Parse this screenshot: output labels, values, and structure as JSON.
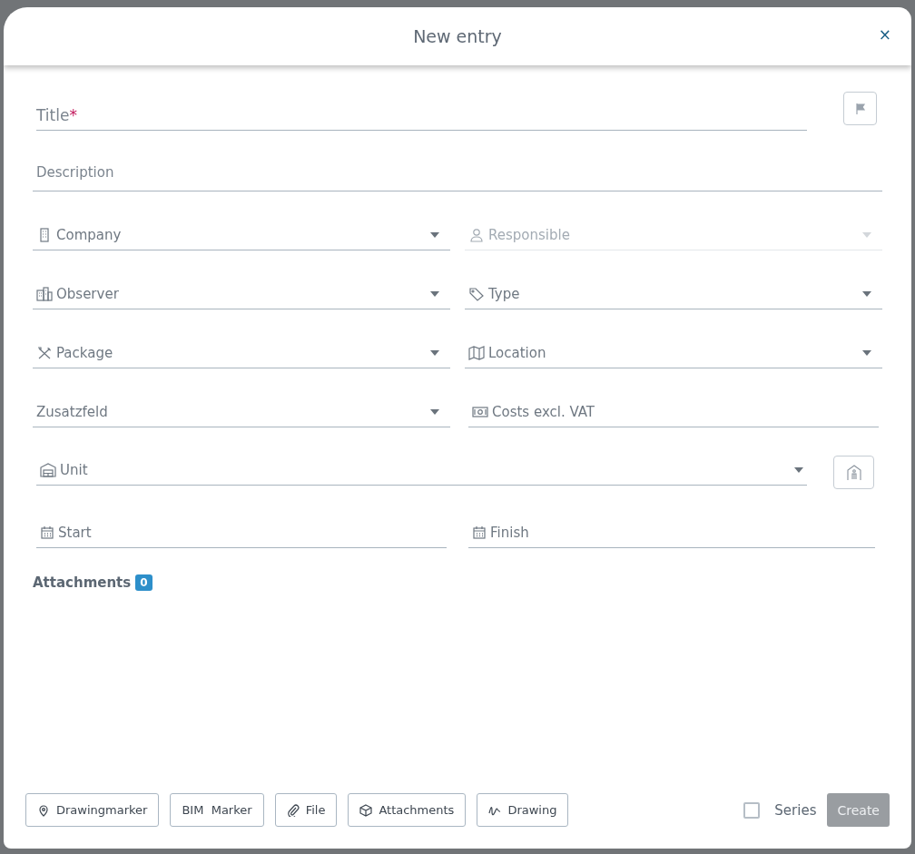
{
  "dialog": {
    "title": "New entry",
    "close": "×"
  },
  "title_field": {
    "placeholder": "Title",
    "required_mark": "*"
  },
  "description_field": {
    "placeholder": "Description"
  },
  "fields": [
    {
      "label": "Company",
      "kind": "select",
      "disabled": false
    },
    {
      "label": "Responsible",
      "kind": "select",
      "disabled": true
    },
    {
      "label": "Observer",
      "kind": "select",
      "disabled": false
    },
    {
      "label": "Type",
      "kind": "select",
      "disabled": false
    },
    {
      "label": "Package",
      "kind": "select",
      "disabled": false
    },
    {
      "label": "Location",
      "kind": "select",
      "disabled": false
    },
    {
      "label": "Zusatzfeld",
      "kind": "select",
      "disabled": false
    },
    {
      "label": "Costs excl. VAT",
      "kind": "input",
      "disabled": false
    }
  ],
  "unit_field": {
    "label": "Unit"
  },
  "date_fields": [
    {
      "label": "Start"
    },
    {
      "label": "Finish"
    }
  ],
  "attachments": {
    "label": "Attachments",
    "count": "0"
  },
  "footer_buttons": [
    {
      "label": "Drawingmarker"
    },
    {
      "label": "BIM  Marker"
    },
    {
      "label": "File"
    },
    {
      "label": "Attachments"
    },
    {
      "label": "Drawing"
    }
  ],
  "series": {
    "label": "Series",
    "checked": false
  },
  "create_button": {
    "label": "Create",
    "disabled": true
  }
}
